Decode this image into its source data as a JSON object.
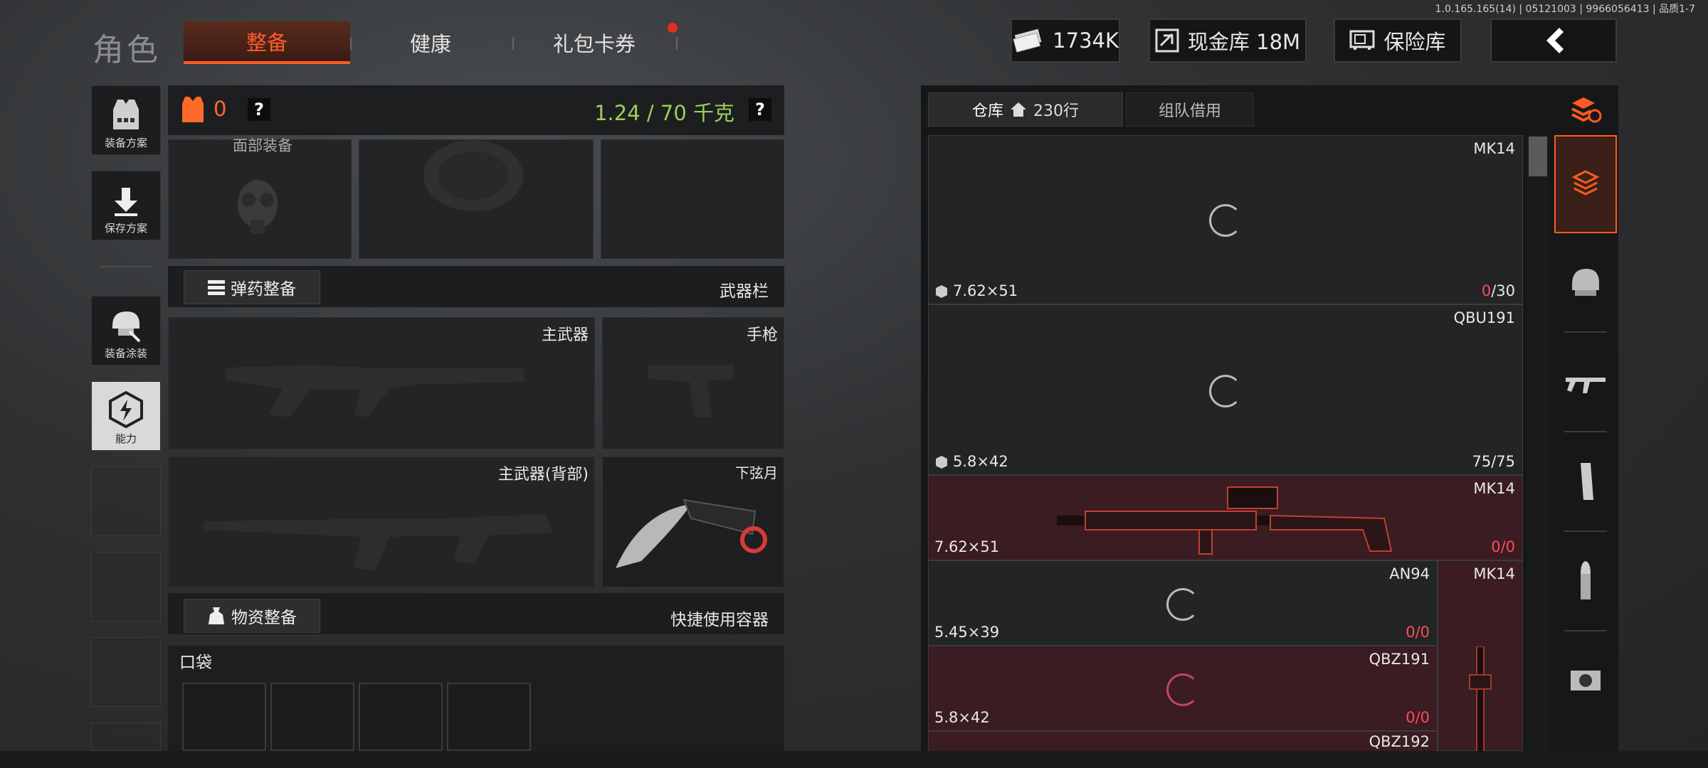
{
  "version_text": "1.0.165.165(14) | 05121003 | 9966056413 | 品质1-7",
  "header": {
    "title": "角色",
    "tabs": [
      {
        "label": "整备",
        "active": true
      },
      {
        "label": "健康",
        "active": false
      },
      {
        "label": "礼包卡券",
        "active": false,
        "has_notification": true
      }
    ],
    "cash": "1734K",
    "cash_vault": "现金库 18M",
    "safe_label": "保险库"
  },
  "sidebar": {
    "items": [
      {
        "label": "装备方案",
        "icon": "vest-plan-icon"
      },
      {
        "label": "保存方案",
        "icon": "download-icon"
      },
      {
        "label": "装备涂装",
        "icon": "helmet-skin-icon"
      },
      {
        "label": "能力",
        "icon": "ability-icon"
      }
    ]
  },
  "loadout": {
    "armor_count": "0",
    "weight": "1.24 / 70 千克",
    "face_gear_label": "面部装备",
    "ammo_button": "弹药整备",
    "weapon_bar_label": "武器栏",
    "primary_label": "主武器",
    "pistol_label": "手枪",
    "primary_back_label": "主武器(背部)",
    "melee_label": "下弦月",
    "supply_button": "物资整备",
    "quick_container_label": "快捷使用容器",
    "pocket_label": "口袋"
  },
  "storage": {
    "tab_storage": "仓库",
    "rows": "230行",
    "tab_team": "组队借用",
    "items": [
      {
        "name": "MK14",
        "ammo": "7.62×51",
        "count_zero": "0",
        "count_rest": "/30"
      },
      {
        "name": "QBU191",
        "ammo": "5.8×42",
        "count_zero": "",
        "count_rest": "75/75"
      },
      {
        "name": "MK14",
        "ammo": "7.62×51",
        "count_zero": "0",
        "count_rest": "/0"
      },
      {
        "name": "AN94",
        "ammo": "5.45×39",
        "count_zero": "0",
        "count_rest": "/0"
      },
      {
        "name": "MK14",
        "ammo": "",
        "count_zero": "",
        "count_rest": ""
      },
      {
        "name": "QBZ191",
        "ammo": "5.8×42",
        "count_zero": "0",
        "count_rest": "/0"
      },
      {
        "name": "QBZ192",
        "ammo": "",
        "count_zero": "",
        "count_rest": ""
      }
    ]
  },
  "categories": [
    {
      "icon": "layers-refresh-icon"
    },
    {
      "icon": "storage-stack-icon",
      "active": true
    },
    {
      "icon": "helmet-icon"
    },
    {
      "icon": "rifle-icon"
    },
    {
      "icon": "magazine-icon"
    },
    {
      "icon": "bullet-icon"
    },
    {
      "icon": "scope-icon"
    }
  ],
  "colors": {
    "accent": "#ff5a1f",
    "weight_green": "#9ad05a",
    "highlight_row": "#3a1c22",
    "zero_red": "#ff4a5a"
  }
}
